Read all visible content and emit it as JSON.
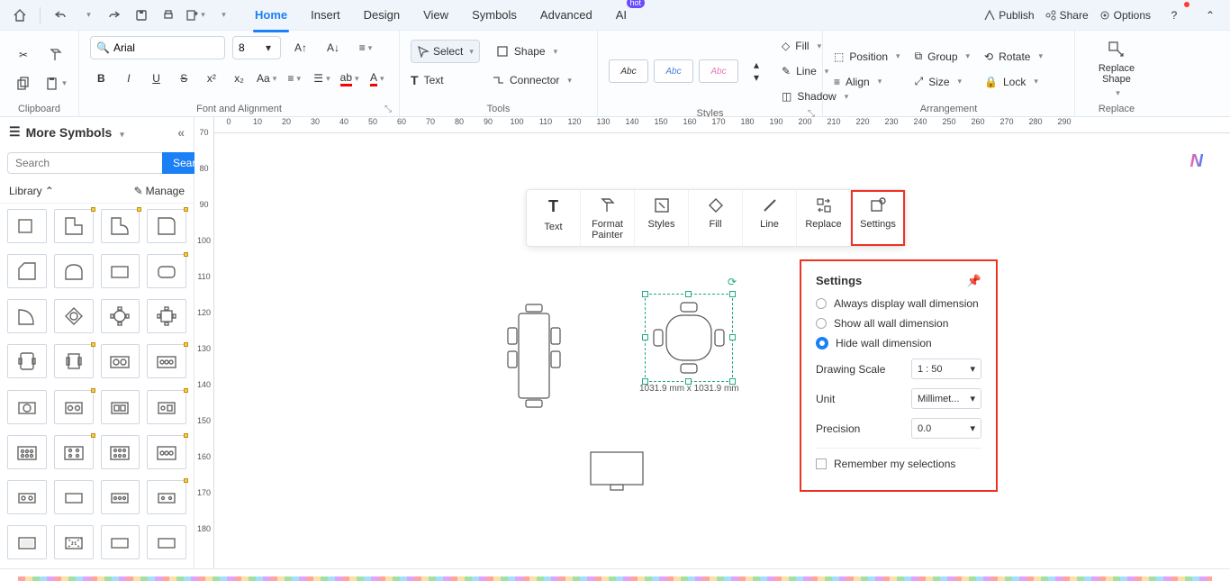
{
  "titlebar_right": {
    "publish": "Publish",
    "share": "Share",
    "options": "Options"
  },
  "tabs": {
    "home": "Home",
    "insert": "Insert",
    "design": "Design",
    "view": "View",
    "symbols": "Symbols",
    "advanced": "Advanced",
    "ai": "AI",
    "hot": "hot"
  },
  "ribbon": {
    "clipboard": "Clipboard",
    "font": {
      "name": "Arial",
      "size": "8",
      "group": "Font and Alignment"
    },
    "tools": {
      "select": "Select",
      "shape": "Shape",
      "text": "Text",
      "connector": "Connector",
      "group": "Tools"
    },
    "styles": {
      "abc": "Abc",
      "fill": "Fill",
      "line": "Line",
      "shadow": "Shadow",
      "group": "Styles"
    },
    "arrange": {
      "position": "Position",
      "group_btn": "Group",
      "rotate": "Rotate",
      "align": "Align",
      "size": "Size",
      "lock": "Lock",
      "group": "Arrangement"
    },
    "replace": {
      "replace_shape": "Replace\nShape",
      "group": "Replace"
    }
  },
  "leftpanel": {
    "more": "More Symbols",
    "search_ph": "Search",
    "search_btn": "Search",
    "library": "Library",
    "manage": "Manage"
  },
  "floatbar": {
    "text": "Text",
    "format": "Format Painter",
    "styles": "Styles",
    "fill": "Fill",
    "line": "Line",
    "replace": "Replace",
    "settings": "Settings"
  },
  "settings": {
    "title": "Settings",
    "opt1": "Always display wall dimension",
    "opt2": "Show all wall dimension",
    "opt3": "Hide wall dimension",
    "scale_l": "Drawing Scale",
    "scale_v": "1 : 50",
    "unit_l": "Unit",
    "unit_v": "Millimet...",
    "prec_l": "Precision",
    "prec_v": "0.0",
    "remember": "Remember my selections"
  },
  "canvas": {
    "sel_dim": "1031.9 mm x 1031.9 mm"
  },
  "ruler_h": [
    0,
    10,
    20,
    30,
    40,
    50,
    60,
    70,
    80,
    90,
    100,
    110,
    120,
    130,
    140,
    150,
    160,
    170,
    180,
    190,
    200,
    210,
    220,
    230,
    240,
    250,
    260,
    270,
    280,
    290
  ],
  "ruler_v": [
    70,
    80,
    90,
    100,
    110,
    120,
    130,
    140,
    150,
    160,
    170,
    180
  ]
}
